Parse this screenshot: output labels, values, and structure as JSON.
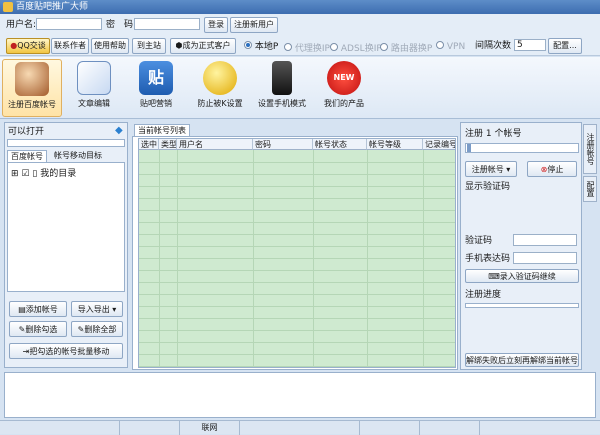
{
  "window": {
    "title": "百度贴吧推广大师"
  },
  "login": {
    "user_label": "用户名:",
    "pwd_label": "密　码:",
    "login_btn": "登录",
    "register_btn": "注册新用户"
  },
  "toolbar": {
    "qq_btn": "QQ交谈",
    "contact_btn": "联系作者",
    "help_btn": "使用帮助",
    "home_btn": "到主站",
    "vip_btn": "成为正式客户",
    "local_ip": "本地P",
    "proxy_options": [
      "代理换IP",
      "ADSL换IP",
      "路由器换P",
      "VPN"
    ],
    "interval_label": "间隔次数",
    "interval_value": "5",
    "config_btn": "配置..."
  },
  "ribbon": [
    "注册百度帐号",
    "文章编辑",
    "贴吧营销",
    "防止被K设置",
    "设置手机模式",
    "我们的产品"
  ],
  "left": {
    "open_label": "可以打开",
    "tabs": [
      "百度帐号",
      "帐号移动目标"
    ],
    "tree_root": "我的目录",
    "buttons": {
      "add": "添加帐号",
      "import": "导入导出",
      "del_checked": "删除勾选",
      "del_all": "删除全部",
      "move": "把勾选的帐号批量移动"
    }
  },
  "main": {
    "tab": "当前帐号列表",
    "columns": [
      "选中",
      "类型",
      "用户名",
      "密码",
      "帐号状态",
      "帐号等级",
      "记录编号"
    ]
  },
  "right": {
    "reg_title": "注册 1 个帐号",
    "reg_btn": "注册帐号",
    "stop_btn": "停止",
    "captcha_label": "显示验证码",
    "code_label": "验证码",
    "phone_label": "手机表达码",
    "enter_btn": "录入验证码继续",
    "progress_label": "注册进度",
    "unbind_btn": "解绑失败后立刻再解绑当前帐号",
    "vtabs": [
      "注册帐号",
      "配置"
    ]
  },
  "status": {
    "mid": "联网"
  },
  "colors": {
    "grid_bg": "#cfead0",
    "panel_bg": "#ffffff",
    "ribbon_bg": "#dde8f5"
  }
}
